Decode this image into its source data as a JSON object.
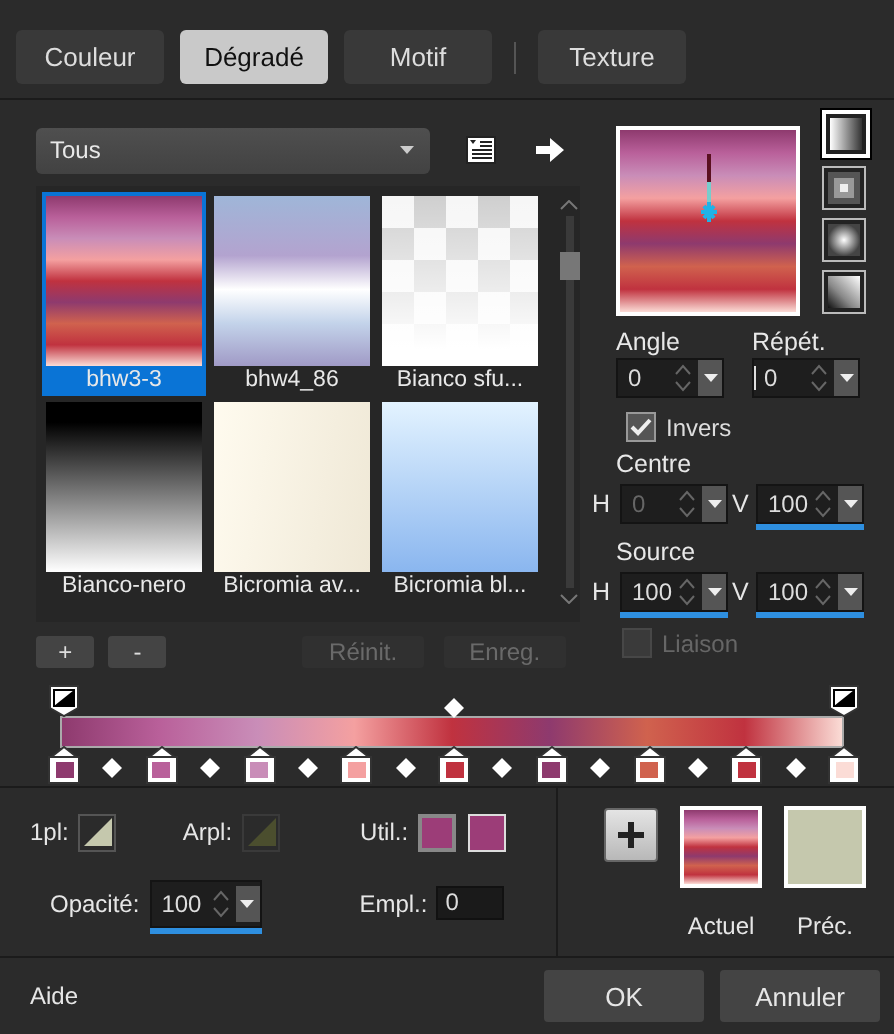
{
  "tabs": [
    {
      "label": "Couleur",
      "selected": false
    },
    {
      "label": "Dégradé",
      "selected": true
    },
    {
      "label": "Motif",
      "selected": false
    },
    {
      "label": "Texture",
      "selected": false
    }
  ],
  "preset_filter": {
    "value": "Tous"
  },
  "presets": [
    {
      "name": "bhw3-3",
      "selected": true
    },
    {
      "name": "bhw4_86",
      "selected": false
    },
    {
      "name": "Bianco sfu...",
      "selected": false
    },
    {
      "name": "Bianco-nero",
      "selected": false
    },
    {
      "name": "Bicromia av...",
      "selected": false
    },
    {
      "name": "Bicromia bl...",
      "selected": false
    }
  ],
  "preset_buttons": [
    {
      "label": "+",
      "disabled": false
    },
    {
      "label": "-",
      "disabled": false
    },
    {
      "label": "Réinit.",
      "disabled": true
    },
    {
      "label": "Enreg.",
      "disabled": true
    }
  ],
  "styles": [
    {
      "kind": "linear",
      "selected": true
    },
    {
      "kind": "rectangular",
      "selected": false
    },
    {
      "kind": "radial",
      "selected": false
    },
    {
      "kind": "corner",
      "selected": false
    }
  ],
  "angle": {
    "label": "Angle",
    "value": "0"
  },
  "repeats": {
    "label": "Répét.",
    "value": "0",
    "focused": true
  },
  "invert": {
    "label": "Invers",
    "checked": true
  },
  "center": {
    "label": "Centre",
    "h": {
      "label": "H",
      "value": "0",
      "disabled": true
    },
    "v": {
      "label": "V",
      "value": "100",
      "disabled": false,
      "level": 1
    }
  },
  "source": {
    "label": "Source",
    "h": {
      "label": "H",
      "value": "100",
      "disabled": false,
      "level": 1
    },
    "v": {
      "label": "V",
      "value": "100",
      "disabled": false,
      "level": 1
    }
  },
  "link": {
    "label": "Liaison",
    "checked": false,
    "disabled": true
  },
  "color_stops": [
    {
      "color": "#8e3a6e"
    },
    {
      "color": "#b9609a"
    },
    {
      "color": "#c98db8"
    },
    {
      "color": "#f4a0a0"
    },
    {
      "color": "#c0323f"
    },
    {
      "color": "#8e3a6e"
    },
    {
      "color": "#d0624e"
    },
    {
      "color": "#c0323f"
    },
    {
      "color": "#fbdcd6"
    }
  ],
  "stop_settings": {
    "foreground": {
      "label": "1pl:",
      "disabled": false
    },
    "background": {
      "label": "Arpl:",
      "disabled": true
    },
    "custom": {
      "label": "Util.:",
      "colors": [
        {
          "color": "#9c3d78",
          "selected": true
        },
        {
          "color": "#9c3d78",
          "selected": false
        }
      ]
    },
    "opacity": {
      "label": "Opacité:",
      "value": "100",
      "level": 1
    },
    "location": {
      "label": "Empl.:",
      "value": "0"
    }
  },
  "swatches": [
    {
      "label": "Actuel",
      "kind": "gradient"
    },
    {
      "label": "Préc.",
      "kind": "solid",
      "color": "#c5c8ad"
    }
  ],
  "footer": {
    "help": "Aide",
    "buttons": [
      "OK",
      "Annuler"
    ]
  }
}
